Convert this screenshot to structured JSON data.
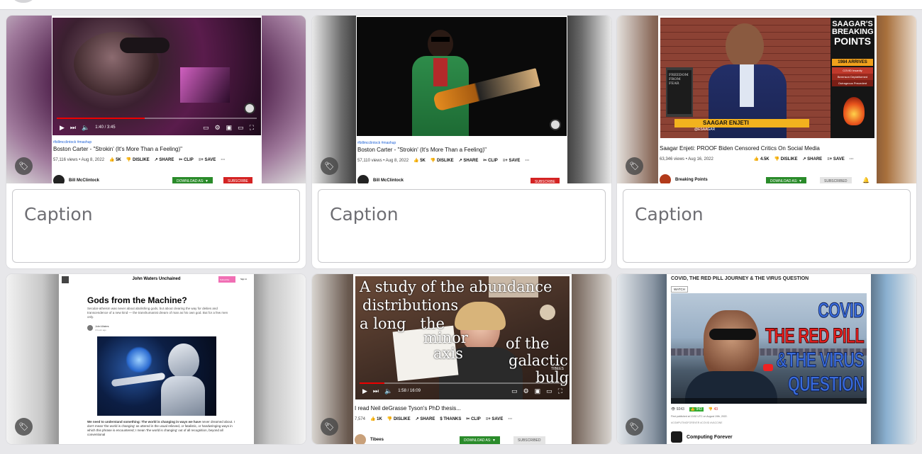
{
  "cards": [
    {
      "caption_placeholder": "Caption",
      "tags": "#billmcclintock #mashup",
      "title": "Boston Carter - \"Strokin' (It's More Than a Feeling)\"",
      "views": "57,116 views • Aug 8, 2022",
      "likes": "5K",
      "dislike": "DISLIKE",
      "share": "SHARE",
      "clip": "CLIP",
      "save": "SAVE",
      "channel": "Bill McClintock",
      "download": "DOWNLOAD AS: ▼",
      "subscribe": "SUBSCRIBE",
      "time": "1:40 / 3:45",
      "progress": 0.44
    },
    {
      "caption_placeholder": "Caption",
      "tags": "#billmcclintock #mashup",
      "title": "Boston Carter - \"Strokin' (It's More Than a Feeling)\"",
      "views": "57,110 views • Aug 8, 2022",
      "likes": "5K",
      "dislike": "DISLIKE",
      "share": "SHARE",
      "clip": "CLIP",
      "save": "SAVE",
      "channel": "Bill McClintock",
      "subscribe": "SUBSCRIBE"
    },
    {
      "caption_placeholder": "Caption",
      "title": "Saagar Enjeti: PROOF Biden Censored Critics On Social Media",
      "views": "63,346 views • Aug 16, 2022",
      "likes": "4.5K",
      "dislike": "DISLIKE",
      "share": "SHARE",
      "save": "SAVE",
      "channel": "Breaking Points",
      "download": "DOWNLOAD AS: ▼",
      "subscribed": "SUBSCRIBED",
      "logo_line1": "SAAGAR'S",
      "logo_line2": "BREAKING",
      "logo_line3": "POINTS",
      "arrives": "1984 ARRIVES",
      "side1": "COVID Insanity",
      "side2": "Berenson Deplatformed",
      "side3": "Outrageous Precedent",
      "lower_third": "SAAGAR ENJETI",
      "lower_handle": "@ESAAGAR",
      "book": "FREEDOM FROM FEAR"
    },
    {
      "site_title": "John Waters Unchained",
      "subscribe": "Subscribe",
      "signin": "Sign in",
      "headline": "Gods from the Machine?",
      "subhead": "Secular-atheism was never about abolishing gods, but about clearing the way for deities and transcendence of a new kind — the transhumanist dream of man as his own god. But for a few men only.",
      "author": "John Waters",
      "date": "3 hours ago",
      "body_bold": "We need to understand something: The world is changing in ways we have",
      "body_rest": "never dreamed about. I don't mean 'the world is changing' as uttered in the usual relieved, or fatalistic, or handwringing ways in which this phrase is encountered; I mean 'the world is changing' out of all recognition, beyond all conventional"
    },
    {
      "overlay_1": "A study of the abundance",
      "overlay_2": "distributions",
      "overlay_3": "a long   the",
      "overlay_4": "minor",
      "overlay_5": "axis",
      "overlay_6": "of the",
      "overlay_7": "galactic",
      "overlay_8": "bulge",
      "watermark": "TIBEES",
      "time": "1:58 / 16:09",
      "progress": 0.12,
      "title": "I read Neil deGrasse Tyson's PhD thesis...",
      "views": "7,574",
      "likes": "1K",
      "dislike": "DISLIKE",
      "share": "SHARE",
      "thanks": "THANKS",
      "clip": "CLIP",
      "save": "SAVE",
      "channel": "Tibees",
      "download": "DOWNLOAD AS: ▼",
      "subscribed": "SUBSCRIBED"
    },
    {
      "header": "COVID, THE RED PILL JOURNEY & THE VIRUS QUESTION",
      "watch": "WATCH",
      "covid": "COVID",
      "red_pill": "THE RED PILL",
      "virus": "&THE VIRUS",
      "question": "QUESTION",
      "views": "9243",
      "likes": "943",
      "dislikes": "43",
      "published": "First published at 13:52 UTC on August 19th, 2022.",
      "hashtags": "#COMPUTINGFOREVER   #COVID   #VACCINE",
      "channel": "Computing Forever"
    }
  ],
  "colors": {
    "youtube_red": "#d42323",
    "download_green": "#2a8b2a",
    "caption_border": "#c9c9cc"
  },
  "icons": [
    "tag-icon",
    "play-icon",
    "thumbs-up-icon",
    "share-icon",
    "settings-icon",
    "fullscreen-icon"
  ]
}
